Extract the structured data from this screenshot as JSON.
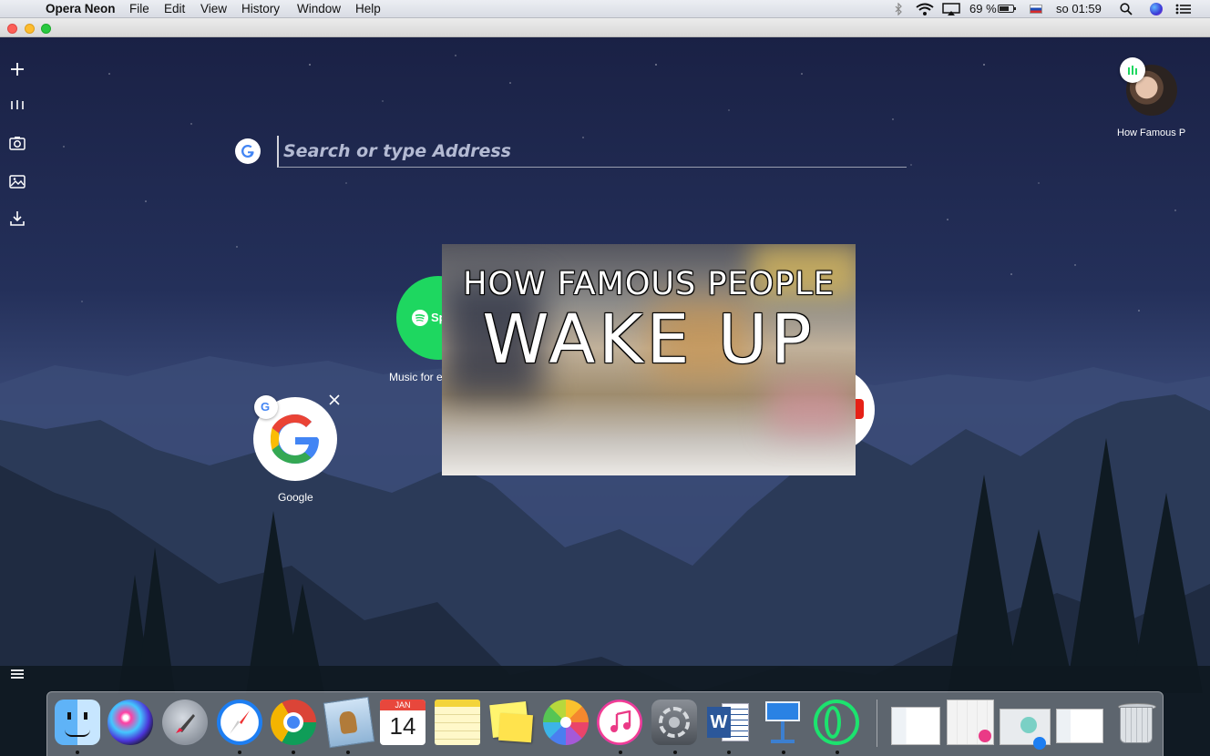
{
  "menubar": {
    "app_name": "Opera Neon",
    "items": [
      "File",
      "Edit",
      "View",
      "History",
      "Window",
      "Help"
    ],
    "battery": "69 %",
    "clock": "so 01:59"
  },
  "sidebar": {
    "icons": [
      "plus-icon",
      "tabs-icon",
      "camera-icon",
      "gallery-icon",
      "download-icon",
      "menu-icon"
    ]
  },
  "search": {
    "placeholder": "Search or type Address"
  },
  "speed_dial": {
    "spotify_label": "Music for every",
    "spotify_logo_text": "Sp",
    "google_label": "Google",
    "google_letter": "G"
  },
  "video_popup": {
    "line1": "HOW FAMOUS PEOPLE",
    "line2": "WAKE UP"
  },
  "player": {
    "label": "How Famous P"
  },
  "dock": {
    "apps": [
      "Finder",
      "Siri",
      "Launchpad",
      "Safari",
      "Chrome",
      "Mail",
      "Calendar",
      "Notes",
      "Stickies",
      "Photos",
      "iTunes",
      "System Preferences",
      "Word",
      "Keynote",
      "Opera Neon"
    ],
    "calendar_month": "JAN",
    "calendar_day": "14"
  }
}
